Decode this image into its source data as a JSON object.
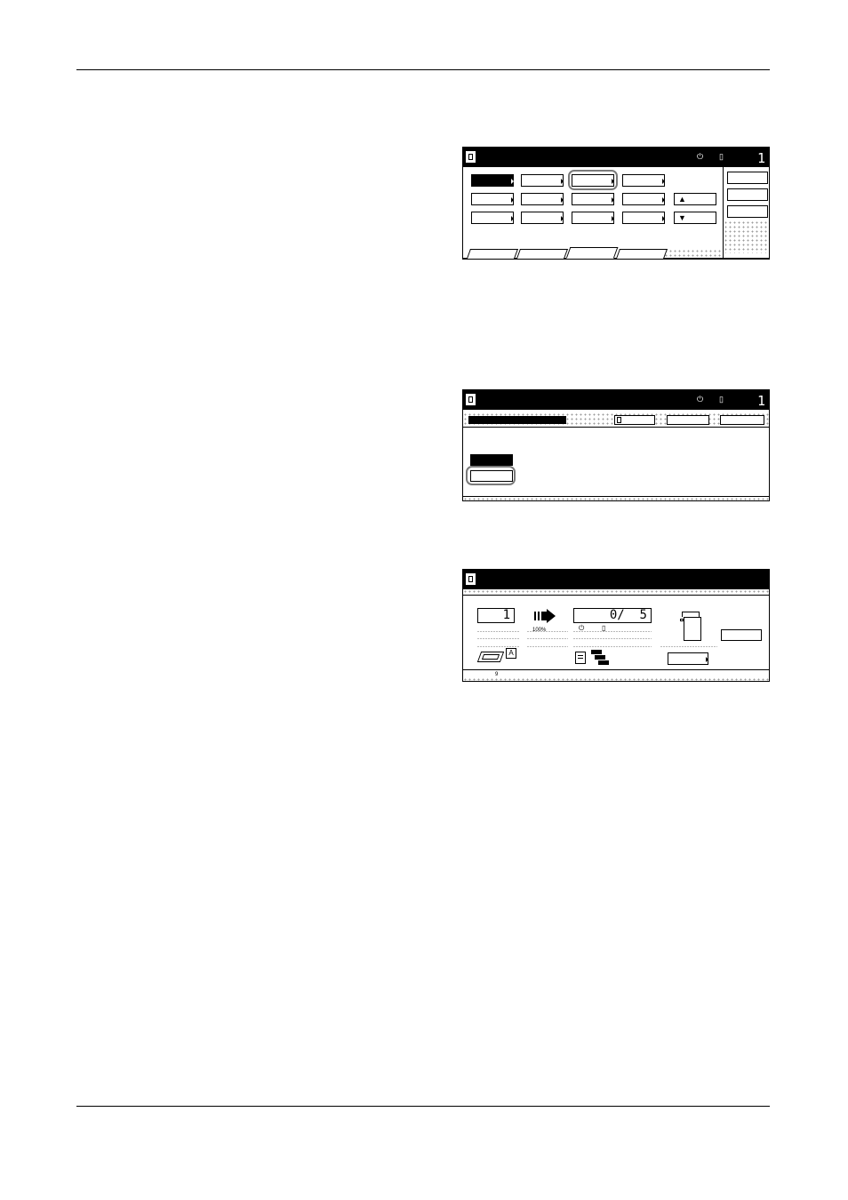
{
  "screens": {
    "screen1": {
      "page_number": "1",
      "arrow_up": "▲",
      "arrow_down": "▼"
    },
    "screen2": {
      "page_number": "1"
    },
    "screen3": {
      "copies_value": "1",
      "zoom_label": "100%",
      "counter_value": "0/  5",
      "footer_number": "9"
    }
  },
  "icons": {
    "power": "power-icon",
    "paper": "paper-icon",
    "document": "document-icon",
    "arrow_right": "arrow-right-icon"
  }
}
